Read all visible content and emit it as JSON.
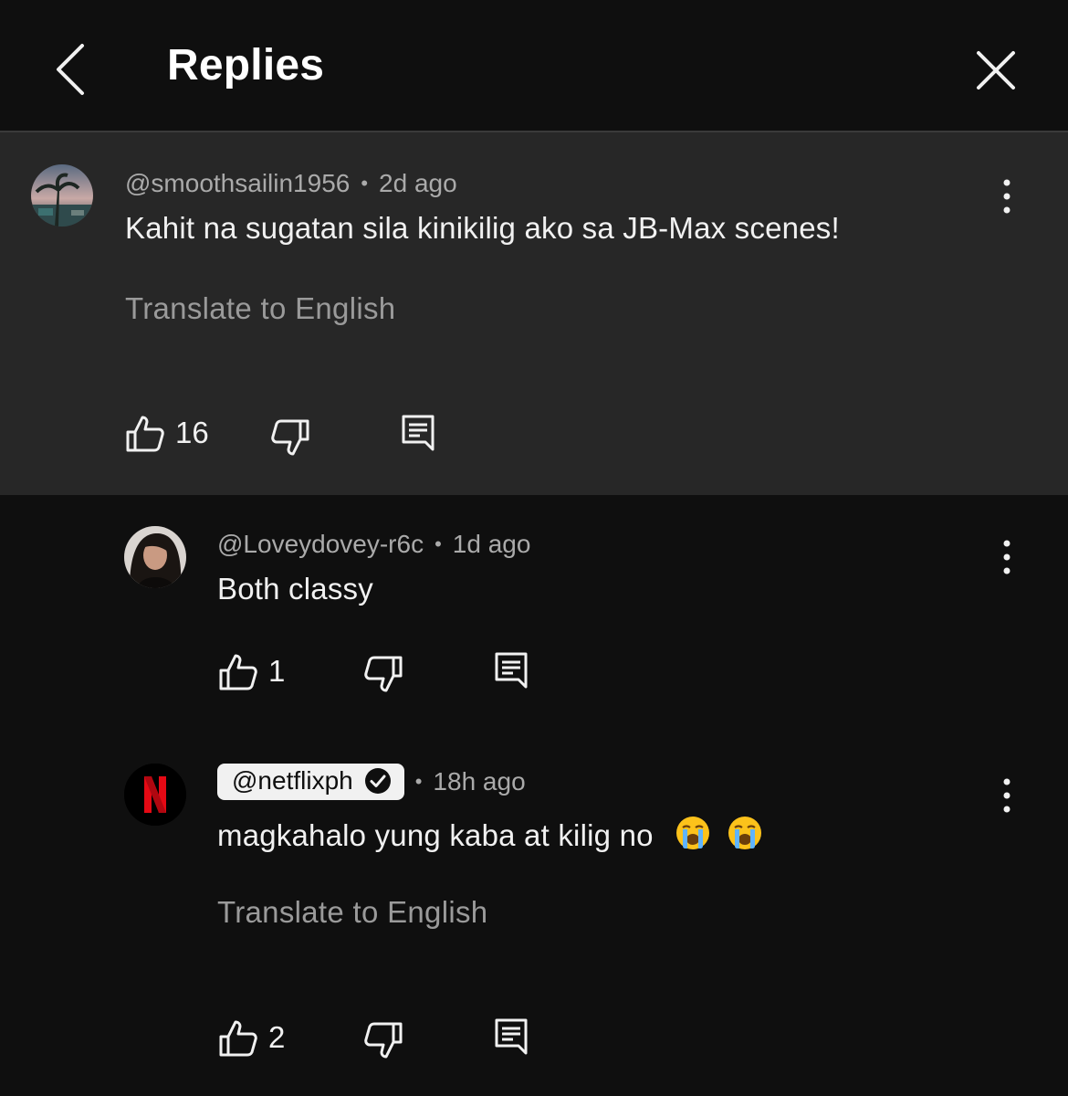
{
  "header": {
    "title": "Replies",
    "back_icon": "chevron-left-icon",
    "close_icon": "close-icon"
  },
  "parent_comment": {
    "handle": "@smoothsailin1956",
    "time": "2d ago",
    "text": "Kahit na sugatan sila kinikilig ako sa JB-Max scenes!",
    "translate": "Translate to English",
    "likes": "16"
  },
  "replies": [
    {
      "handle": "@Loveydovey-r6c",
      "time": "1d ago",
      "text": "Both classy",
      "likes": "1"
    },
    {
      "handle": "@netflixph",
      "time": "18h ago",
      "text": "magkahalo yung kaba at kilig no",
      "emojis": [
        "loudly-crying-face",
        "loudly-crying-face"
      ],
      "translate": "Translate to English",
      "likes": "2",
      "verified": true,
      "avatar_letter": "N"
    }
  ],
  "colors": {
    "background": "#0f0f0f",
    "highlight": "#272727",
    "text": "#f1f1f1",
    "secondary": "#aaaaaa",
    "netflix_red": "#e50914"
  }
}
